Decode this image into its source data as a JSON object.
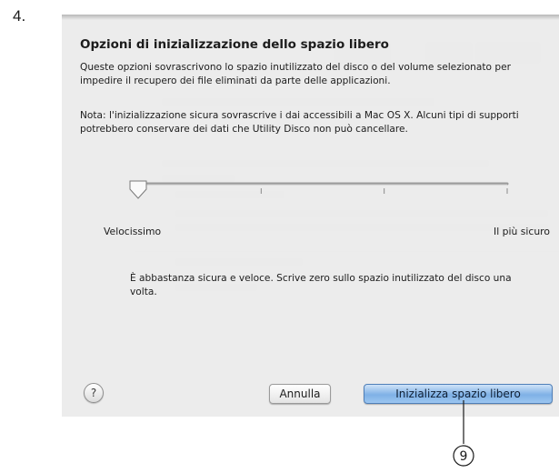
{
  "step": {
    "number": "4."
  },
  "dialog": {
    "title": "Opzioni di inizializzazione dello spazio libero",
    "description": "Queste opzioni sovrascrivono lo spazio inutilizzato del disco o del volume selezionato per impedire il recupero dei file eliminati da parte delle applicazioni.",
    "note": "Nota: l'inizializzazione sicura sovrascrive i dai accessibili a Mac OS X. Alcuni tipi di supporti potrebbero conservare dei dati che Utility Disco non può cancellare.",
    "slider": {
      "min_label": "Velocissimo",
      "max_label": "Il più sicuro",
      "level": 0,
      "tick_count": 4
    },
    "level_description": "È abbastanza sicura e veloce. Scrive zero sullo spazio inutilizzato del disco una volta.",
    "help_label": "?",
    "cancel_label": "Annulla",
    "primary_label": "Inizializza spazio libero"
  },
  "callout": {
    "number": "9"
  },
  "colors": {
    "primary_button": "#7fb1e6",
    "sheet_background": "#ececec"
  }
}
